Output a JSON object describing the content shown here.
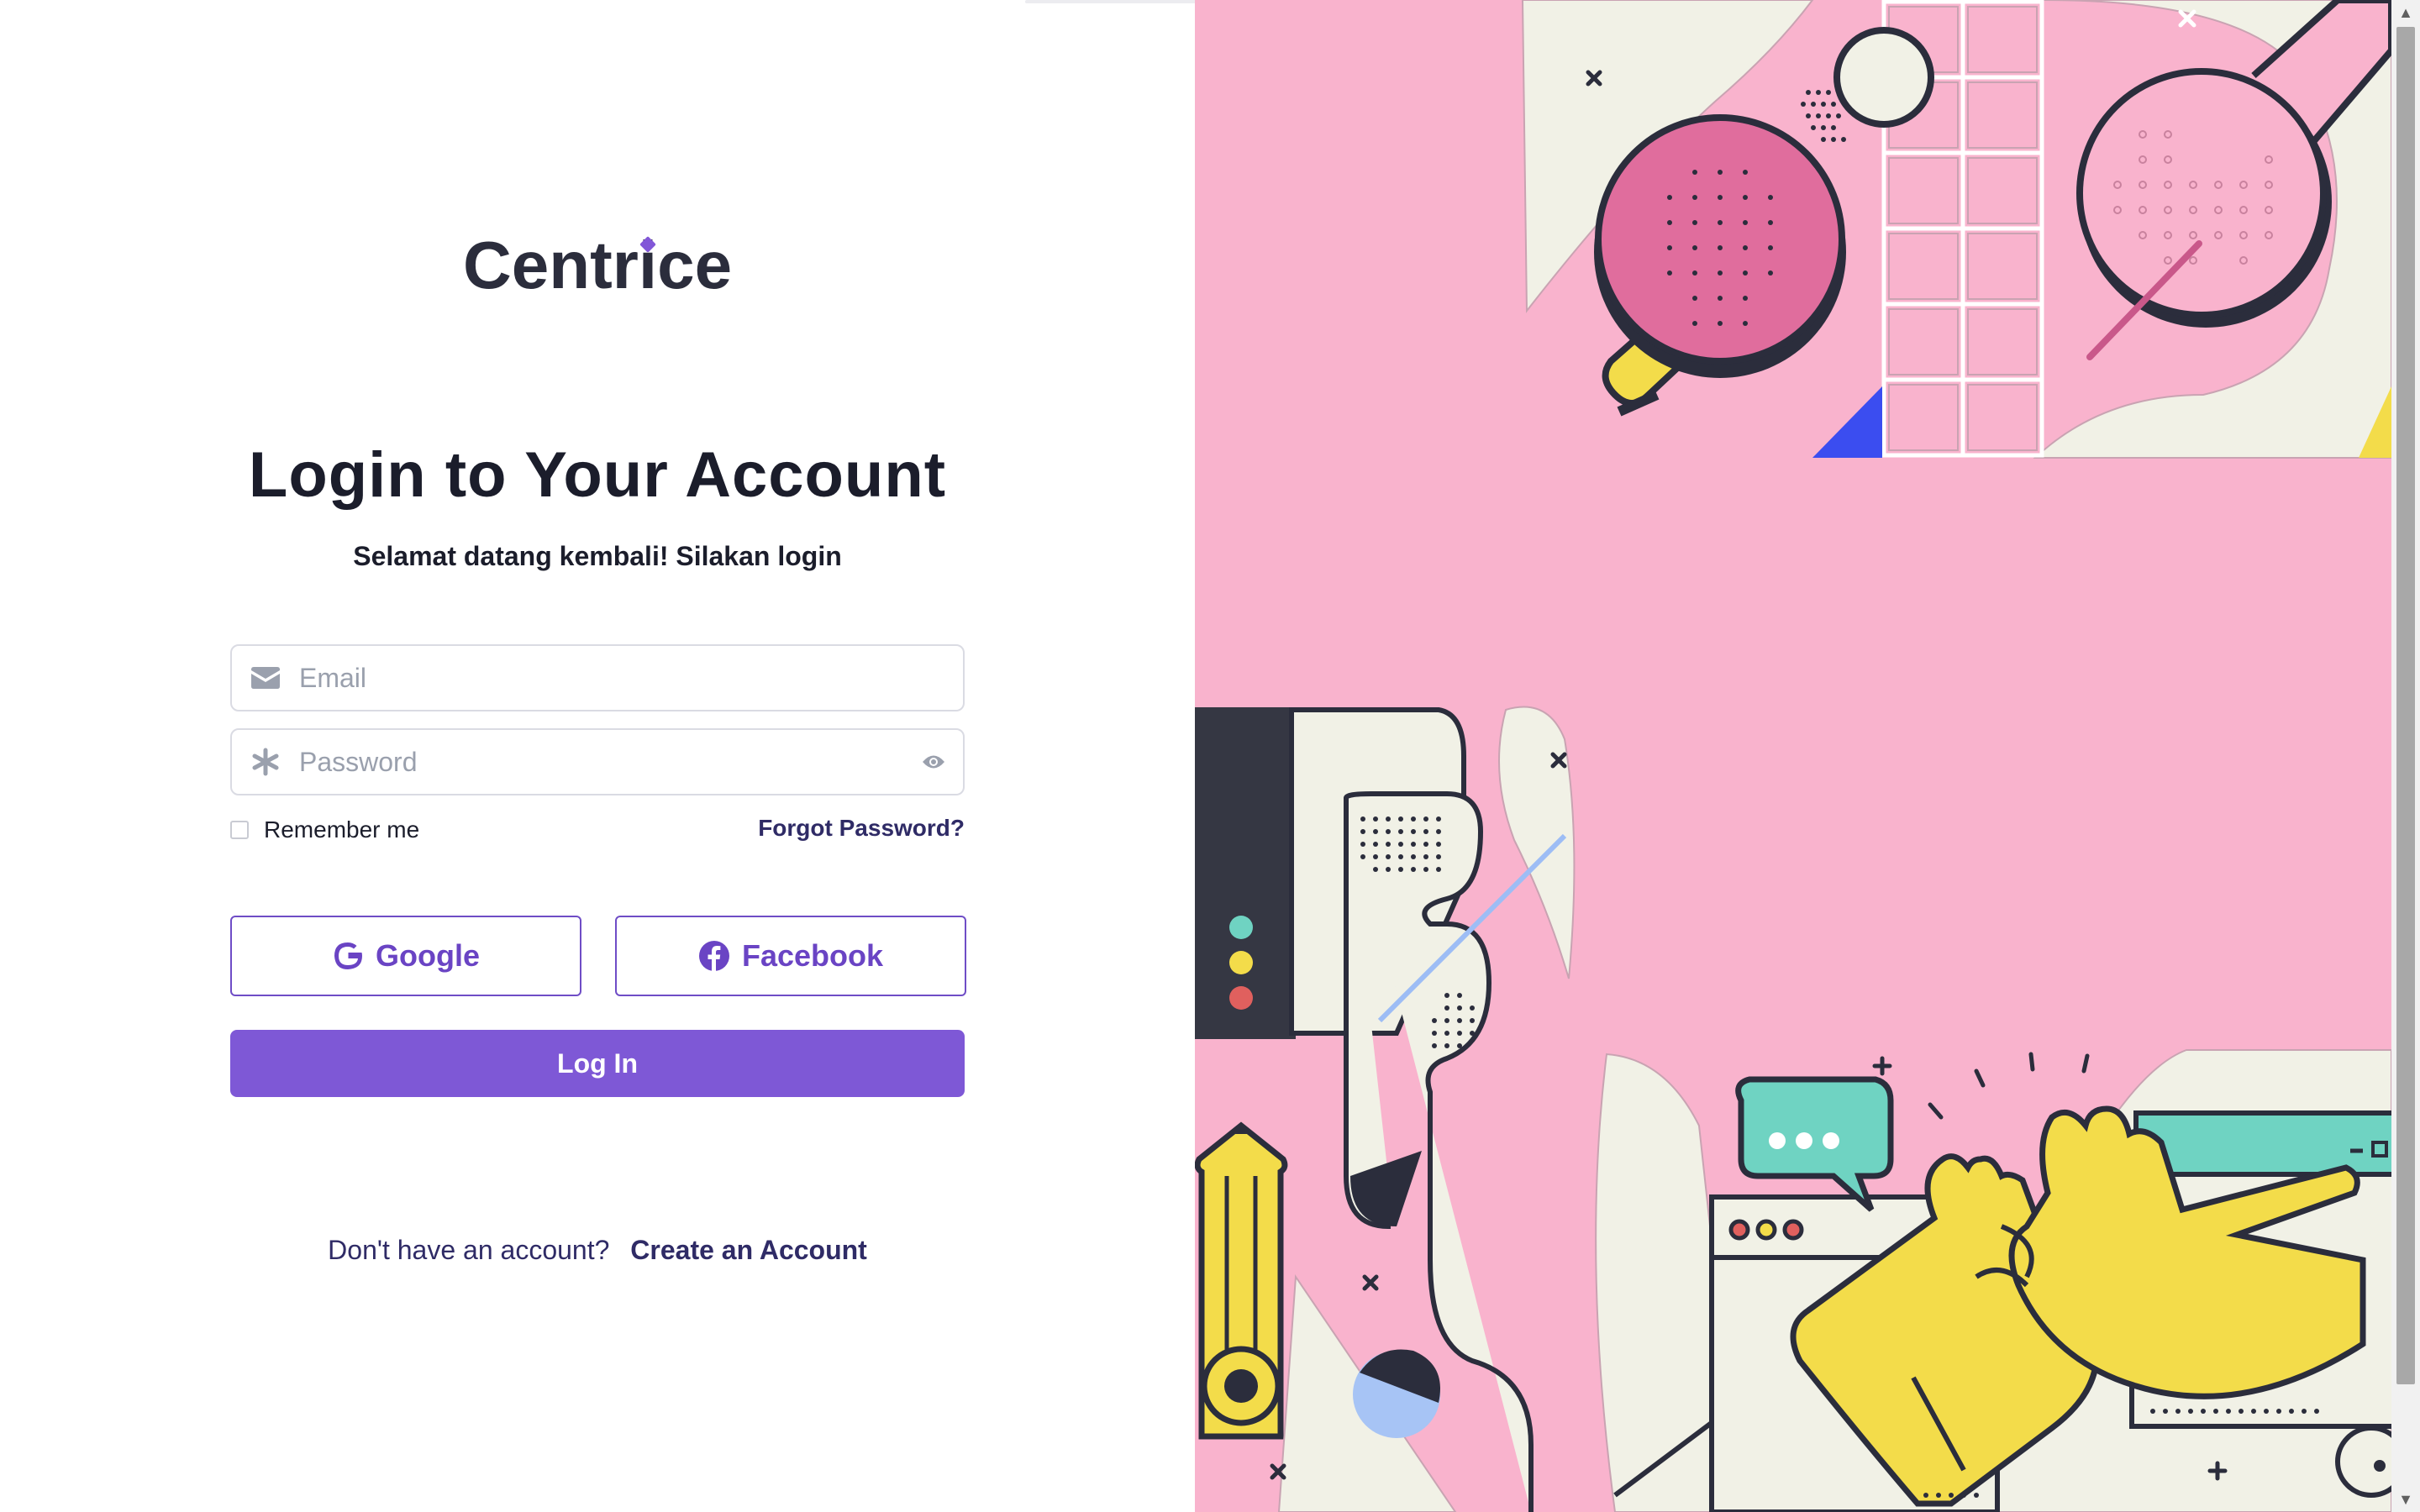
{
  "brand": {
    "logo_part1": "Centr",
    "logo_i": "i",
    "logo_part2": "ce",
    "accent": "#8257d8"
  },
  "login": {
    "title": "Login to Your Account",
    "subtitle": "Selamat datang kembali! Silakan login",
    "email_placeholder": "Email",
    "password_placeholder": "Password",
    "remember_label": "Remember me",
    "remember_checked": false,
    "forgot_label": "Forgot Password?",
    "google_label": "Google",
    "facebook_label": "Facebook",
    "submit_label": "Log In",
    "signup_question": "Don't have an account?",
    "signup_link": "Create an Account"
  },
  "icons": {
    "email": "envelope-icon",
    "password": "asterisk-icon",
    "toggle": "eye-icon",
    "google": "google-icon",
    "facebook": "facebook-icon"
  },
  "colors": {
    "primary": "#7e58d6",
    "illustration_bg": "#f9b3cd",
    "text_dark": "#1b1d2b",
    "link": "#2f2b66"
  }
}
